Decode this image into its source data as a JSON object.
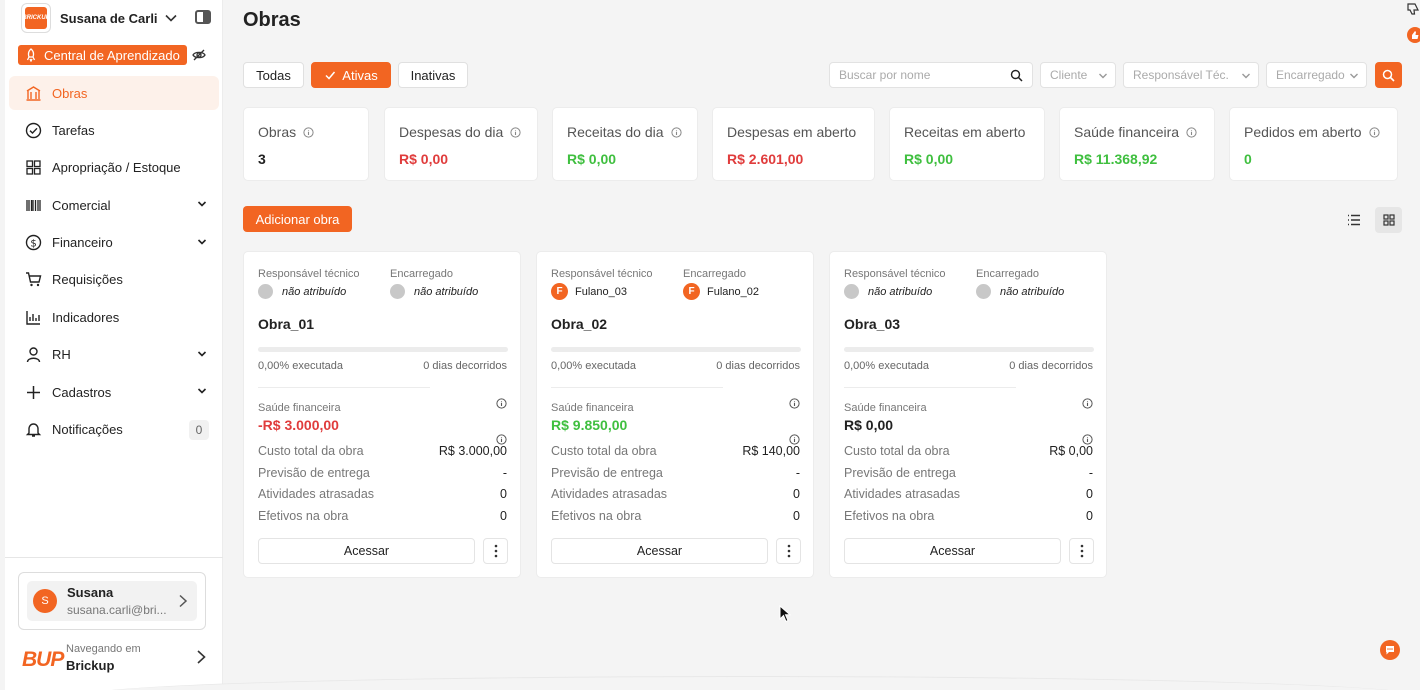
{
  "workspace": {
    "name": "Susana de Carli",
    "logo_text": "BRICKUP"
  },
  "learning": {
    "label": "Central de Aprendizado"
  },
  "nav": {
    "items": [
      {
        "label": "Obras",
        "icon": "building-icon",
        "active": true
      },
      {
        "label": "Tarefas",
        "icon": "check-circle-icon"
      },
      {
        "label": "Apropriação / Estoque",
        "icon": "grid-icon"
      },
      {
        "label": "Comercial",
        "icon": "barcode-icon",
        "expandable": true
      },
      {
        "label": "Financeiro",
        "icon": "dollar-circle-icon",
        "expandable": true
      },
      {
        "label": "Requisições",
        "icon": "cart-icon"
      },
      {
        "label": "Indicadores",
        "icon": "bar-chart-icon"
      },
      {
        "label": "RH",
        "icon": "user-icon",
        "expandable": true
      },
      {
        "label": "Cadastros",
        "icon": "plus-icon",
        "expandable": true
      },
      {
        "label": "Notificações",
        "icon": "bell-icon",
        "count": "0"
      }
    ]
  },
  "user": {
    "initial": "S",
    "name": "Susana",
    "email": "susana.carli@bri..."
  },
  "brand": {
    "logo_text": "BUP",
    "sub": "Navegando em",
    "name": "Brickup"
  },
  "page": {
    "title": "Obras"
  },
  "filters": {
    "all": "Todas",
    "active": "Ativas",
    "inactive": "Inativas"
  },
  "search": {
    "placeholder": "Buscar por nome",
    "value": ""
  },
  "dropdowns": {
    "client": "Cliente",
    "tech": "Responsável Téc.",
    "foreman": "Encarregado"
  },
  "stats": [
    {
      "label": "Obras",
      "value": "3",
      "tone": "dark",
      "info": true
    },
    {
      "label": "Despesas do dia",
      "value": "R$ 0,00",
      "tone": "red",
      "info": true
    },
    {
      "label": "Receitas do dia",
      "value": "R$ 0,00",
      "tone": "green",
      "info": true
    },
    {
      "label": "Despesas em aberto",
      "value": "R$ 2.601,00",
      "tone": "red",
      "info": false
    },
    {
      "label": "Receitas em aberto",
      "value": "R$ 0,00",
      "tone": "green",
      "info": false
    },
    {
      "label": "Saúde financeira",
      "value": "R$ 11.368,92",
      "tone": "green",
      "info": true
    },
    {
      "label": "Pedidos em aberto",
      "value": "0",
      "tone": "green",
      "info": true
    }
  ],
  "actions": {
    "add": "Adicionar obra"
  },
  "card_labels": {
    "tech": "Responsável técnico",
    "foreman": "Encarregado",
    "financial_health": "Saúde financeira",
    "total_cost": "Custo total da obra",
    "delivery": "Previsão de entrega",
    "late": "Atividades atrasadas",
    "staff": "Efetivos na obra",
    "open": "Acessar"
  },
  "cards": [
    {
      "title": "Obra_01",
      "tech": {
        "name": "não atribuído",
        "initial": ""
      },
      "foreman": {
        "name": "não atribuído",
        "initial": ""
      },
      "progress": 0,
      "executed": "0,00% executada",
      "days": "0 dias decorridos",
      "health": "-R$ 3.000,00",
      "health_tone": "red",
      "total_cost": "R$ 3.000,00",
      "delivery": "-",
      "late": "0",
      "staff": "0"
    },
    {
      "title": "Obra_02",
      "tech": {
        "name": "Fulano_03",
        "initial": "F"
      },
      "foreman": {
        "name": "Fulano_02",
        "initial": "F"
      },
      "progress": 0,
      "executed": "0,00% executada",
      "days": "0 dias decorridos",
      "health": "R$ 9.850,00",
      "health_tone": "green",
      "total_cost": "R$ 140,00",
      "delivery": "-",
      "late": "0",
      "staff": "0"
    },
    {
      "title": "Obra_03",
      "tech": {
        "name": "não atribuído",
        "initial": ""
      },
      "foreman": {
        "name": "não atribuído",
        "initial": ""
      },
      "progress": 0,
      "executed": "0,00% executada",
      "days": "0 dias decorridos",
      "health": "R$ 0,00",
      "health_tone": "dark",
      "total_cost": "R$ 0,00",
      "delivery": "-",
      "late": "0",
      "staff": "0"
    }
  ],
  "colors": {
    "accent": "#f26522",
    "red": "#e03c3c",
    "green": "#3fbf3f"
  }
}
